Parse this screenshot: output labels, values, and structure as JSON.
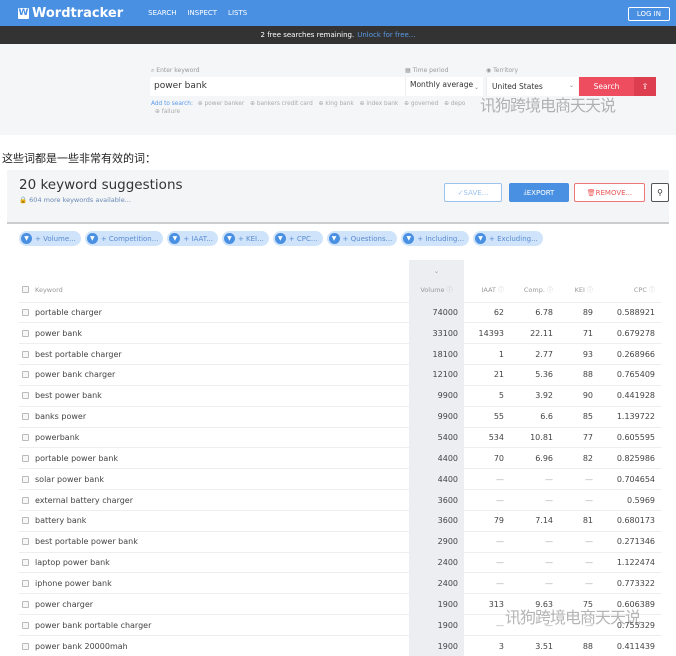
{
  "nav": {
    "logo": "Wordtracker",
    "links": [
      "SEARCH",
      "INSPECT",
      "LISTS"
    ],
    "login": "LOG IN"
  },
  "banner": {
    "text": "2 free searches remaining.",
    "link": "Unlock for free..."
  },
  "search": {
    "keyword_label": "Enter keyword",
    "keyword_value": "power bank",
    "time_label": "Time period",
    "time_value": "Monthly average",
    "territory_label": "Territory",
    "territory_value": "United States",
    "search_button": "Search",
    "add_label": "Add to search:",
    "add_items": [
      "power banker",
      "bankers credit card",
      "king bank",
      "index bank",
      "governed",
      "depo",
      "failure"
    ]
  },
  "watermark": "讯狗跨境电商天天说",
  "caption": "这些词都是一些非常有效的词：",
  "results": {
    "title": "20 keyword suggestions",
    "subtitle": "604 more keywords available...",
    "save": "SAVE...",
    "export": "EXPORT",
    "remove": "REMOVE...",
    "filters": [
      "+ Volume...",
      "+ Competition...",
      "+ IAAT...",
      "+ KEI...",
      "+ CPC...",
      "+ Questions...",
      "+ Including...",
      "+ Excluding..."
    ],
    "columns": [
      "Keyword",
      "Volume",
      "IAAT",
      "Comp.",
      "KEI",
      "CPC"
    ],
    "rows": [
      [
        "portable charger",
        "74000",
        "62",
        "6.78",
        "89",
        "0.588921"
      ],
      [
        "power bank",
        "33100",
        "14393",
        "22.11",
        "71",
        "0.679278"
      ],
      [
        "best portable charger",
        "18100",
        "1",
        "2.77",
        "93",
        "0.268966"
      ],
      [
        "power bank charger",
        "12100",
        "21",
        "5.36",
        "88",
        "0.765409"
      ],
      [
        "best power bank",
        "9900",
        "5",
        "3.92",
        "90",
        "0.441928"
      ],
      [
        "banks power",
        "9900",
        "55",
        "6.6",
        "85",
        "1.139722"
      ],
      [
        "powerbank",
        "5400",
        "534",
        "10.81",
        "77",
        "0.605595"
      ],
      [
        "portable power bank",
        "4400",
        "70",
        "6.96",
        "82",
        "0.825986"
      ],
      [
        "solar power bank",
        "4400",
        "—",
        "—",
        "—",
        "0.704654"
      ],
      [
        "external battery charger",
        "3600",
        "—",
        "—",
        "—",
        "0.5969"
      ],
      [
        "battery bank",
        "3600",
        "79",
        "7.14",
        "81",
        "0.680173"
      ],
      [
        "best portable power bank",
        "2900",
        "—",
        "—",
        "—",
        "0.271346"
      ],
      [
        "laptop power bank",
        "2400",
        "—",
        "—",
        "—",
        "1.122474"
      ],
      [
        "iphone power bank",
        "2400",
        "—",
        "—",
        "—",
        "0.773322"
      ],
      [
        "power charger",
        "1900",
        "313",
        "9.63",
        "75",
        "0.606389"
      ],
      [
        "power bank portable charger",
        "1900",
        "—",
        "—",
        "—",
        "0.755329"
      ],
      [
        "power bank 20000mah",
        "1900",
        "3",
        "3.51",
        "88",
        "0.411439"
      ]
    ]
  }
}
